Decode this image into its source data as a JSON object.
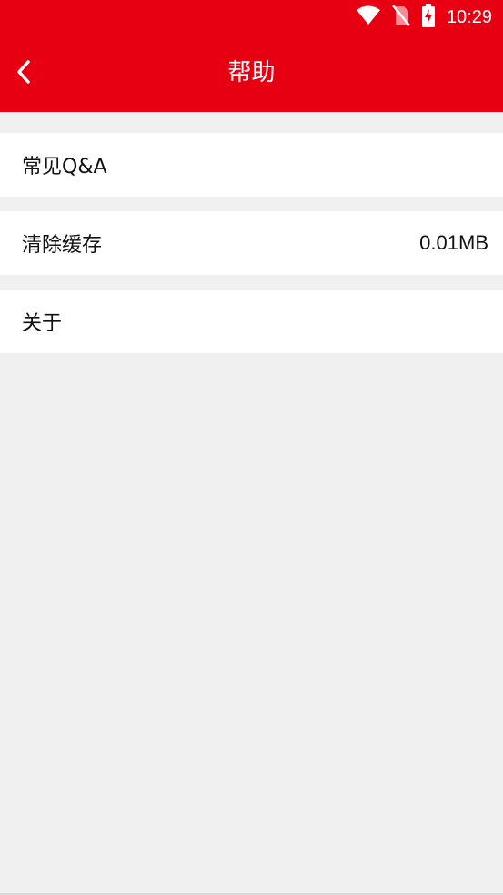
{
  "status_bar": {
    "time": "10:29",
    "icons": [
      "wifi-icon",
      "no-sim-icon",
      "battery-charging-icon"
    ]
  },
  "toolbar": {
    "title": "帮助",
    "back_icon": "chevron-left-icon"
  },
  "colors": {
    "header_bg": "#e60012",
    "page_bg": "#f0f0f0",
    "item_bg": "#ffffff",
    "text": "#111111"
  },
  "menu": {
    "items": [
      {
        "label": "常见Q&A",
        "value": ""
      },
      {
        "label": "清除缓存",
        "value": "0.01MB"
      },
      {
        "label": "关于",
        "value": ""
      }
    ]
  }
}
